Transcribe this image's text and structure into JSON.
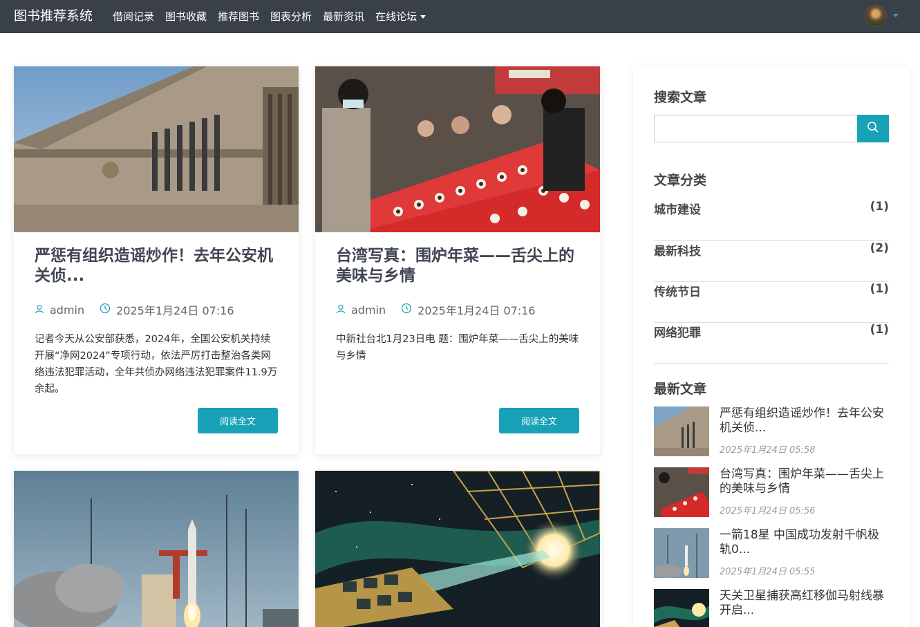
{
  "nav": {
    "brand": "图书推荐系统",
    "links": [
      "借阅记录",
      "图书收藏",
      "推荐图书",
      "图表分析",
      "最新资讯"
    ],
    "dropdown": "在线论坛"
  },
  "cards": [
    {
      "title": "严惩有组织造谣炒作！去年公安机关侦...",
      "author": "admin",
      "date": "2025年1月24日 07:16",
      "excerpt": "记者今天从公安部获悉，2024年，全国公安机关持续开展“净网2024”专项行动，依法严厉打击整治各类网络违法犯罪活动，全年共侦办网络违法犯罪案件11.9万余起。",
      "button": "阅读全文"
    },
    {
      "title": "台湾写真：围炉年菜——舌尖上的美味与乡情",
      "author": "admin",
      "date": "2025年1月24日 07:16",
      "excerpt": "中新社台北1月23日电 题：围炉年菜——舌尖上的美味与乡情",
      "button": "阅读全文"
    }
  ],
  "sidebar": {
    "search_heading": "搜索文章",
    "search_placeholder": "",
    "categories_heading": "文章分类",
    "categories": [
      {
        "name": "城市建设",
        "count": "(1)"
      },
      {
        "name": "最新科技",
        "count": "(2)"
      },
      {
        "name": "传统节日",
        "count": "(1)"
      },
      {
        "name": "网络犯罪",
        "count": "(1)"
      }
    ],
    "recent_heading": "最新文章",
    "recent": [
      {
        "title": "严惩有组织造谣炒作！去年公安机关侦...",
        "date": "2025年1月24日 05:58"
      },
      {
        "title": "台湾写真：围炉年菜——舌尖上的美味与乡情",
        "date": "2025年1月24日 05:56"
      },
      {
        "title": "一箭18星 中国成功发射千帆极轨0...",
        "date": "2025年1月24日 05:55"
      },
      {
        "title": "天关卫星捕获高红移伽马射线暴 开启...",
        "date": ""
      }
    ]
  },
  "colors": {
    "navbar": "#3a4047",
    "accent": "#17a2b8"
  },
  "icons": [
    "user-icon",
    "clock-icon",
    "search-icon",
    "caret-down-icon"
  ]
}
